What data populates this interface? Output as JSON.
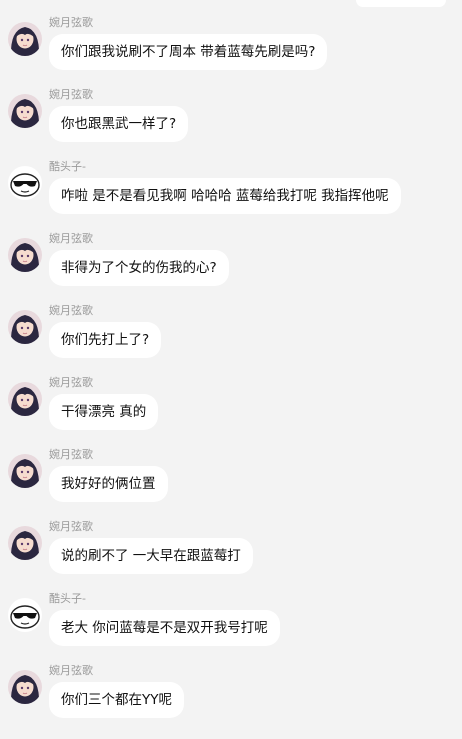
{
  "senders": {
    "a": "婉月弦歌",
    "b": "酷头子-"
  },
  "messages": [
    {
      "sender": "婉月弦歌",
      "avatar": "anime-girl-avatar",
      "text": "你们跟我说刷不了周本 带着蓝莓先刷是吗?"
    },
    {
      "sender": "婉月弦歌",
      "avatar": "anime-girl-avatar",
      "text": "你也跟黑武一样了?"
    },
    {
      "sender": "酷头子-",
      "avatar": "sunglasses-face-avatar",
      "text": "咋啦 是不是看见我啊 哈哈哈 蓝莓给我打呢 我指挥他呢"
    },
    {
      "sender": "婉月弦歌",
      "avatar": "anime-girl-avatar",
      "text": "非得为了个女的伤我的心?"
    },
    {
      "sender": "婉月弦歌",
      "avatar": "anime-girl-avatar",
      "text": "你们先打上了?"
    },
    {
      "sender": "婉月弦歌",
      "avatar": "anime-girl-avatar",
      "text": "干得漂亮 真的"
    },
    {
      "sender": "婉月弦歌",
      "avatar": "anime-girl-avatar",
      "text": "我好好的俩位置"
    },
    {
      "sender": "婉月弦歌",
      "avatar": "anime-girl-avatar",
      "text": "说的刷不了 一大早在跟蓝莓打"
    },
    {
      "sender": "酷头子-",
      "avatar": "sunglasses-face-avatar",
      "text": "老大 你问蓝莓是不是双开我号打呢"
    },
    {
      "sender": "婉月弦歌",
      "avatar": "anime-girl-avatar",
      "text": "你们三个都在YY呢"
    }
  ]
}
